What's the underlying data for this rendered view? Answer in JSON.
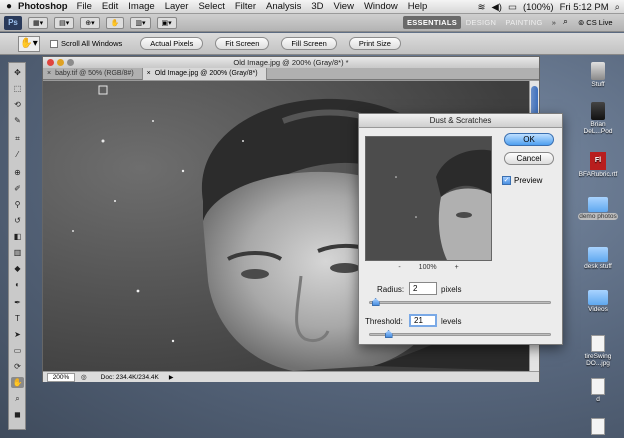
{
  "menubar": {
    "app_name": "Photoshop",
    "items": [
      "File",
      "Edit",
      "Image",
      "Layer",
      "Select",
      "Filter",
      "Analysis",
      "3D",
      "View",
      "Window",
      "Help"
    ],
    "battery": "(100%)",
    "clock": "Fri 5:12 PM"
  },
  "appbar": {
    "logo": "Ps",
    "workspaces": {
      "essentials": "ESSENTIALS",
      "design": "DESIGN",
      "painting": "PAINTING",
      "more": "»"
    },
    "cs_live": "CS Live"
  },
  "options": {
    "scroll_all": "Scroll All Windows",
    "actual_pixels": "Actual Pixels",
    "fit_screen": "Fit Screen",
    "fill_screen": "Fill Screen",
    "print_size": "Print Size"
  },
  "document": {
    "title": "Old Image.jpg @ 200% (Gray/8*) *",
    "tabs": [
      {
        "label": "baby.tif @ 50% (RGB/8#)"
      },
      {
        "label": "Old Image.jpg @ 200% (Gray/8*)"
      }
    ],
    "zoom": "200%",
    "doc_info": "Doc: 234.4K/234.4K"
  },
  "dialog": {
    "title": "Dust & Scratches",
    "ok": "OK",
    "cancel": "Cancel",
    "preview": "Preview",
    "preview_zoom": "100%",
    "zoom_out": "-",
    "zoom_in": "+",
    "radius_label": "Radius:",
    "radius_value": "2",
    "radius_unit": "pixels",
    "radius_fraction": 0.02,
    "threshold_label": "Threshold:",
    "threshold_value": "21",
    "threshold_unit": "levels",
    "threshold_fraction": 0.08
  },
  "desktop": {
    "icons": [
      {
        "label": "Stuff"
      },
      {
        "label": "Brian DeL...Pod"
      },
      {
        "label": "BFARubric.rtf"
      },
      {
        "label": "demo photos"
      },
      {
        "label": "desk stuff"
      },
      {
        "label": "Videos"
      },
      {
        "label": "tireSwing DO...jpg"
      },
      {
        "label": "d"
      }
    ]
  }
}
